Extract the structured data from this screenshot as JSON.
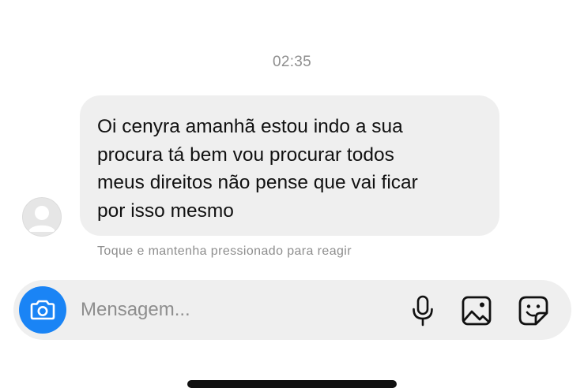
{
  "conversation": {
    "timestamp": "02:35",
    "message": {
      "lines": [
        "Oi cenyra amanhã estou indo a sua",
        "procura tá bem vou procurar todos",
        "meus direitos não pense que vai ficar",
        "por isso mesmo"
      ]
    },
    "react_hint": "Toque e mantenha pressionado para reagir"
  },
  "composer": {
    "placeholder": "Mensagem...",
    "icons": {
      "camera": "camera-icon",
      "mic": "microphone-icon",
      "gallery": "image-icon",
      "sticker": "sticker-icon"
    },
    "accent_color": "#1a84f5"
  }
}
